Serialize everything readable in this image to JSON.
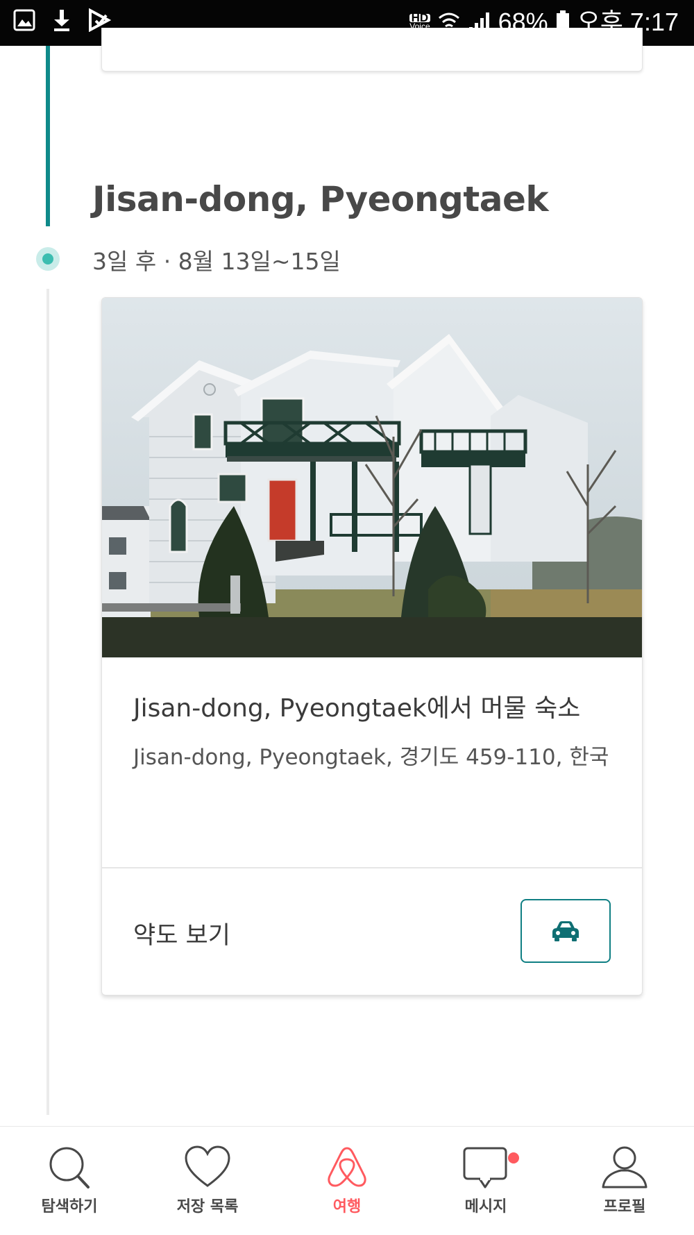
{
  "status_bar": {
    "hd_top": "HD",
    "hd_bottom": "Voice",
    "battery": "68%",
    "time": "오후 7:17"
  },
  "trip": {
    "title": "Jisan-dong, Pyeongtaek",
    "dates": "3일 후 · 8월 13일~15일"
  },
  "card": {
    "title": "Jisan-dong, Pyeongtaek에서 머물 숙소",
    "address": "Jisan-dong, Pyeongtaek, 경기도 459-110, 한국",
    "map_link": "약도 보기",
    "car_icon": "car-icon"
  },
  "nav": {
    "items": [
      {
        "label": "탐색하기",
        "icon": "search-icon"
      },
      {
        "label": "저장 목록",
        "icon": "heart-icon"
      },
      {
        "label": "여행",
        "icon": "airbnb-logo-icon"
      },
      {
        "label": "메시지",
        "icon": "message-icon"
      },
      {
        "label": "프로필",
        "icon": "profile-icon"
      }
    ],
    "active_index": 2,
    "active_color": "#ff5a5f"
  },
  "colors": {
    "teal": "#0f8a8a",
    "dot": "#3cbdb0"
  }
}
